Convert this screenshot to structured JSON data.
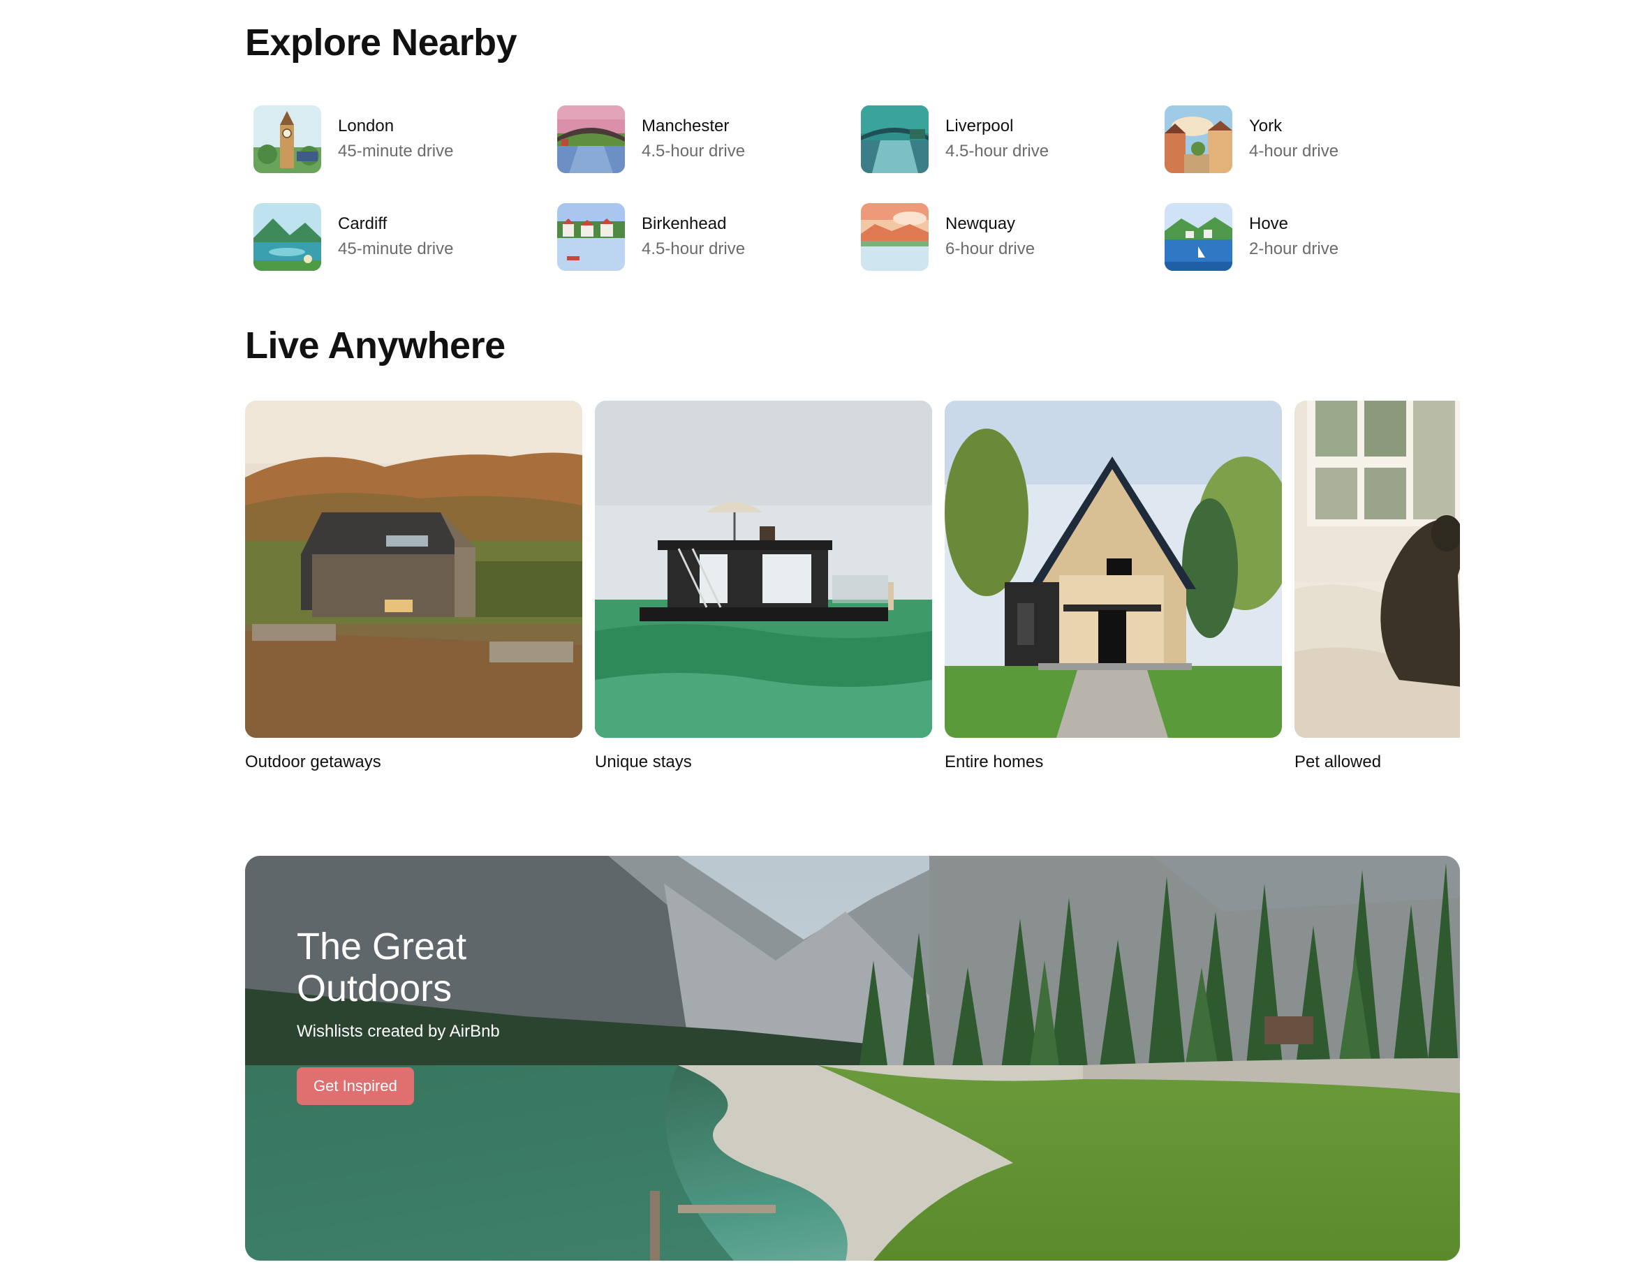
{
  "explore": {
    "title": "Explore Nearby",
    "items": [
      {
        "city": "London",
        "drive": "45-minute drive",
        "icon": "big-ben-illustration"
      },
      {
        "city": "Manchester",
        "drive": "4.5-hour drive",
        "icon": "bridge-canal-illustration"
      },
      {
        "city": "Liverpool",
        "drive": "4.5-hour drive",
        "icon": "bridge-river-illustration"
      },
      {
        "city": "York",
        "drive": "4-hour drive",
        "icon": "town-street-illustration"
      },
      {
        "city": "Cardiff",
        "drive": "45-minute drive",
        "icon": "lake-mountains-illustration"
      },
      {
        "city": "Birkenhead",
        "drive": "4.5-hour drive",
        "icon": "harbor-houses-illustration"
      },
      {
        "city": "Newquay",
        "drive": "6-hour drive",
        "icon": "coast-sunset-illustration"
      },
      {
        "city": "Hove",
        "drive": "2-hour drive",
        "icon": "seaside-town-illustration"
      }
    ]
  },
  "live": {
    "title": "Live Anywhere",
    "cards": [
      {
        "label": "Outdoor getaways"
      },
      {
        "label": "Unique stays"
      },
      {
        "label": "Entire homes"
      },
      {
        "label": "Pet allowed"
      }
    ]
  },
  "banner": {
    "title": "The Great Outdoors",
    "subtitle": "Wishlists created by AirBnb",
    "button_label": "Get Inspired",
    "button_color": "#e0706f"
  }
}
